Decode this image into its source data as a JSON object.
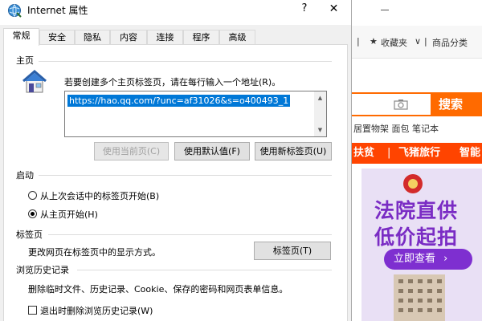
{
  "dialog": {
    "title": "Internet 属性",
    "help_glyph": "?",
    "close_glyph": "✕",
    "tabs": [
      {
        "label": "常规",
        "active": true
      },
      {
        "label": "安全"
      },
      {
        "label": "隐私"
      },
      {
        "label": "内容"
      },
      {
        "label": "连接"
      },
      {
        "label": "程序"
      },
      {
        "label": "高级"
      }
    ],
    "homepage": {
      "group_label": "主页",
      "description": "若要创建多个主页标签页，请在每行输入一个地址(R)。",
      "url": "https://hao.qq.com/?unc=af31026&s=o400493_1",
      "buttons": {
        "use_current": "使用当前页(C)",
        "use_default": "使用默认值(F)",
        "use_new_tab": "使用新标签页(U)"
      }
    },
    "startup": {
      "group_label": "启动",
      "options": [
        {
          "label": "从上次会话中的标签页开始(B)",
          "checked": false
        },
        {
          "label": "从主页开始(H)",
          "checked": true
        }
      ]
    },
    "tabs_section": {
      "group_label": "标签页",
      "description": "更改网页在标签页中的显示方式。",
      "button": "标签页(T)"
    },
    "history": {
      "group_label": "浏览历史记录",
      "description": "删除临时文件、历史记录、Cookie、保存的密码和网页表单信息。",
      "checkbox_label": "退出时删除浏览历史记录(W)",
      "checked": false
    }
  },
  "background_page": {
    "toolbar": {
      "favorites": "收藏夹",
      "categories": "商品分类",
      "chevron": "∨"
    },
    "search_button": "搜索",
    "hot_words": "居置物架 面包 笔记本",
    "channels": [
      "扶贫",
      "飞猪旅行",
      "智能"
    ],
    "banner": {
      "line1": "法院直供",
      "line2": "低价起拍",
      "button": "立即查看"
    },
    "accent_color": "#ff6a00"
  }
}
